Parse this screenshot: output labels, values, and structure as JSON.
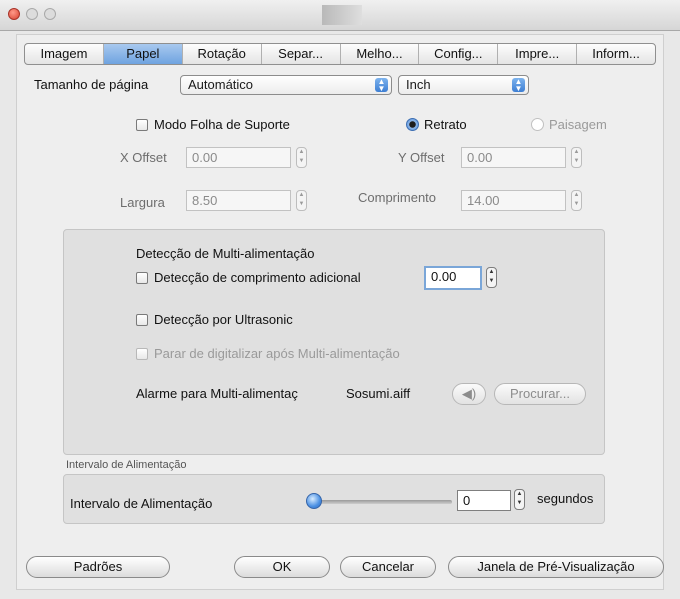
{
  "tabs": [
    {
      "label": "Imagem"
    },
    {
      "label": "Papel"
    },
    {
      "label": "Rotação"
    },
    {
      "label": "Separ..."
    },
    {
      "label": "Melho..."
    },
    {
      "label": "Config..."
    },
    {
      "label": "Impre..."
    },
    {
      "label": "Inform..."
    }
  ],
  "page_size": {
    "label": "Tamanho de página",
    "value": "Automático",
    "unit": "Inch"
  },
  "support_sheet": {
    "label": "Modo Folha de Suporte",
    "checked": false
  },
  "orientation": {
    "portrait": "Retrato",
    "landscape": "Paisagem",
    "selected": "Retrato"
  },
  "offsets": {
    "x_label": "X Offset",
    "x_value": "0.00",
    "y_label": "Y Offset",
    "y_value": "0.00",
    "width_label": "Largura",
    "width_value": "8.50",
    "length_label": "Comprimento",
    "length_value": "14.00"
  },
  "multifeed": {
    "title": "Detecção de Multi-alimentação",
    "extra_length_label": "Detecção de comprimento adicional",
    "extra_length_value": "0.00",
    "ultrasonic_label": "Detecção por Ultrasonic",
    "stop_label": "Parar de digitalizar após Multi-alimentação",
    "alarm_label": "Alarme para Multi-alimentaç",
    "alarm_file": "Sosumi.aiff",
    "browse_label": "Procurar..."
  },
  "feed_interval": {
    "group_title": "Intervalo de Alimentação",
    "label": "Intervalo de Alimentação",
    "value": "0",
    "unit": "segundos",
    "slider_fraction": 0
  },
  "buttons": {
    "defaults": "Padrões",
    "ok": "OK",
    "cancel": "Cancelar",
    "preview": "Janela de Pré-Visualização"
  },
  "colors": {
    "accent": "#4e88d6",
    "close": "#d8412f"
  },
  "icons": {
    "speaker": "speaker-icon",
    "select_arrows": "updown-arrow-icon"
  }
}
